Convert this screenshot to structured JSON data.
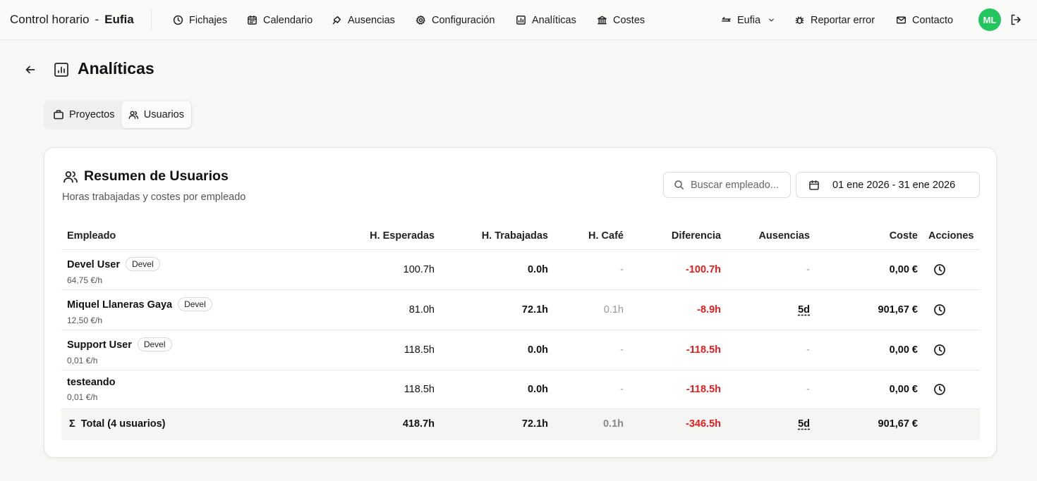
{
  "app": {
    "title": "Control horario",
    "separator": "-",
    "company": "Eufia"
  },
  "nav": {
    "items": [
      {
        "label": "Fichajes",
        "icon": "clock-icon"
      },
      {
        "label": "Calendario",
        "icon": "calendar-icon"
      },
      {
        "label": "Ausencias",
        "icon": "plane-icon"
      },
      {
        "label": "Configuración",
        "icon": "gear-icon"
      },
      {
        "label": "Analíticas",
        "icon": "chart-icon"
      },
      {
        "label": "Costes",
        "icon": "bank-icon"
      }
    ],
    "org_switch": "Eufia",
    "report": "Reportar error",
    "contact": "Contacto",
    "avatar_initials": "ML",
    "avatar_color": "#22c55e"
  },
  "page": {
    "title": "Analíticas",
    "tabs": [
      {
        "label": "Proyectos",
        "active": false
      },
      {
        "label": "Usuarios",
        "active": true
      }
    ]
  },
  "card": {
    "title": "Resumen de Usuarios",
    "subtitle": "Horas trabajadas y costes por empleado",
    "search_placeholder": "Buscar empleado...",
    "date_range": "01 ene 2026 - 31 ene 2026"
  },
  "table": {
    "headers": {
      "employee": "Empleado",
      "expected": "H. Esperadas",
      "worked": "H. Trabajadas",
      "coffee": "H. Café",
      "diff": "Diferencia",
      "absences": "Ausencias",
      "cost": "Coste",
      "actions": "Acciones"
    },
    "rows": [
      {
        "name": "Devel User",
        "badge": "Devel",
        "rate": "64,75 €/h",
        "expected": "100.7h",
        "worked": "0.0h",
        "coffee": "-",
        "diff": "-100.7h",
        "absences": "-",
        "cost": "0,00 €"
      },
      {
        "name": "Miquel Llaneras Gaya",
        "badge": "Devel",
        "rate": "12,50 €/h",
        "expected": "81.0h",
        "worked": "72.1h",
        "coffee": "0.1h",
        "diff": "-8.9h",
        "absences": "5d",
        "cost": "901,67 €"
      },
      {
        "name": "Support User",
        "badge": "Devel",
        "rate": "0,01 €/h",
        "expected": "118.5h",
        "worked": "0.0h",
        "coffee": "-",
        "diff": "-118.5h",
        "absences": "-",
        "cost": "0,00 €"
      },
      {
        "name": "testeando",
        "badge": "",
        "rate": "0,01 €/h",
        "expected": "118.5h",
        "worked": "0.0h",
        "coffee": "-",
        "diff": "-118.5h",
        "absences": "-",
        "cost": "0,00 €"
      }
    ],
    "total": {
      "symbol": "Σ",
      "label": "Total (4 usuarios)",
      "expected": "418.7h",
      "worked": "72.1h",
      "coffee": "0.1h",
      "diff": "-346.5h",
      "absences": "5d",
      "cost": "901,67 €"
    }
  }
}
